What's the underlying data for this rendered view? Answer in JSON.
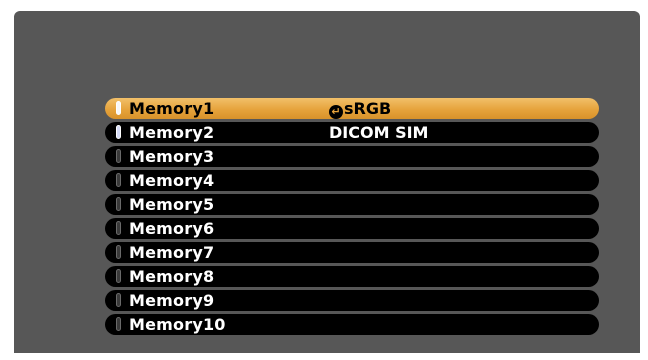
{
  "menu": {
    "items": [
      {
        "label": "Memory1",
        "value": "sRGB",
        "state": "selected"
      },
      {
        "label": "Memory2",
        "value": "DICOM SIM",
        "state": "on"
      },
      {
        "label": "Memory3",
        "value": "",
        "state": "off"
      },
      {
        "label": "Memory4",
        "value": "",
        "state": "off"
      },
      {
        "label": "Memory5",
        "value": "",
        "state": "off"
      },
      {
        "label": "Memory6",
        "value": "",
        "state": "off"
      },
      {
        "label": "Memory7",
        "value": "",
        "state": "off"
      },
      {
        "label": "Memory8",
        "value": "",
        "state": "off"
      },
      {
        "label": "Memory9",
        "value": "",
        "state": "off"
      },
      {
        "label": "Memory10",
        "value": "",
        "state": "off"
      }
    ],
    "enter_glyph": "↵"
  },
  "icons": {
    "enter": "enter-icon",
    "toggle": "toggle-indicator-icon"
  },
  "colors": {
    "panel": "#575757",
    "row": "#000000",
    "highlight": "#e6a33c",
    "text": "#ffffff"
  }
}
